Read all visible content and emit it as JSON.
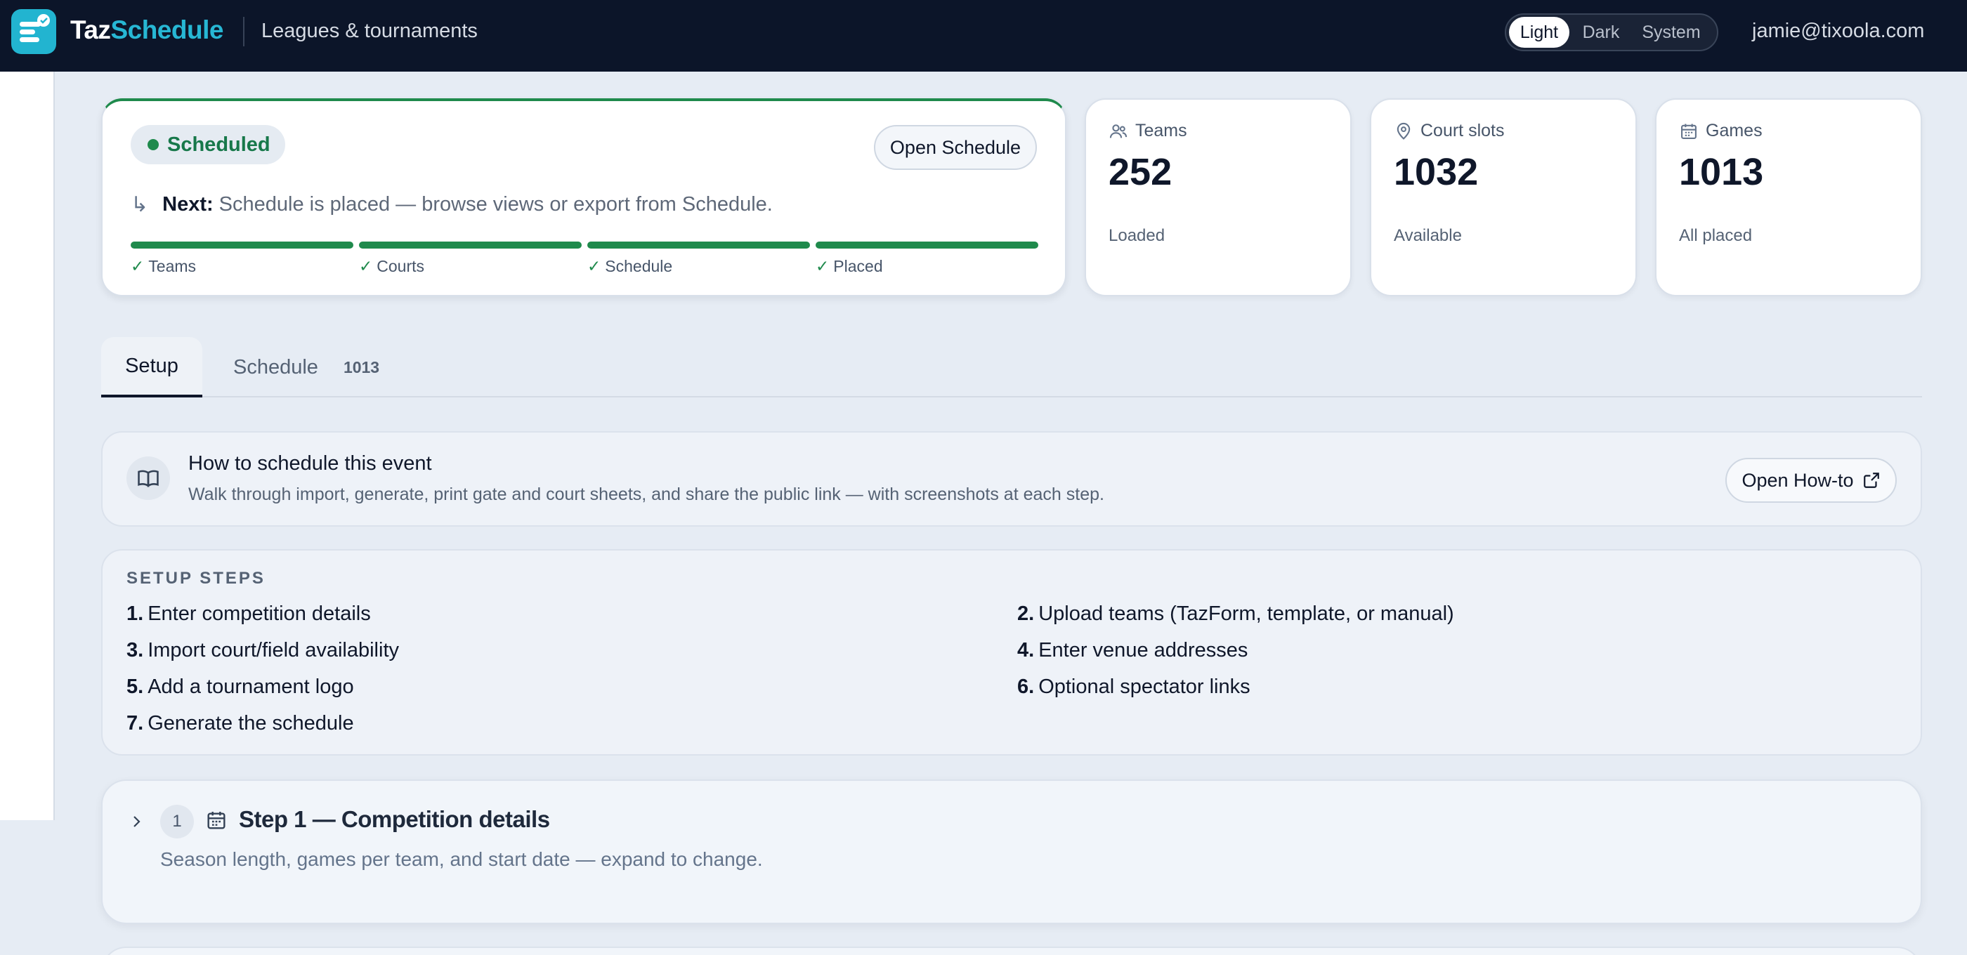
{
  "app": {
    "brand_part1": "Taz",
    "brand_part2": "Schedule",
    "subtitle": "Leagues & tournaments",
    "user_email": "jamie@tixoola.com"
  },
  "theme": {
    "options": [
      "Light",
      "Dark",
      "System"
    ],
    "selected": "Light"
  },
  "status": {
    "label": "Scheduled",
    "open_button": "Open Schedule",
    "next_label": "Next:",
    "next_text": "Schedule is placed — browse views or export from Schedule.",
    "steps": [
      {
        "label": "Teams",
        "complete": true
      },
      {
        "label": "Courts",
        "complete": true
      },
      {
        "label": "Schedule",
        "complete": true
      },
      {
        "label": "Placed",
        "complete": true
      }
    ]
  },
  "stats": [
    {
      "label": "Teams",
      "value": "252",
      "sub": "Loaded",
      "icon": "users-icon"
    },
    {
      "label": "Court slots",
      "value": "1032",
      "sub": "Available",
      "icon": "map-pin-icon"
    },
    {
      "label": "Games",
      "value": "1013",
      "sub": "All placed",
      "icon": "calendar-icon"
    }
  ],
  "tabs": {
    "setup": "Setup",
    "schedule": "Schedule",
    "schedule_count": "1013"
  },
  "howto": {
    "title": "How to schedule this event",
    "description": "Walk through import, generate, print gate and court sheets, and share the public link — with screenshots at each step.",
    "button": "Open How-to"
  },
  "setup_steps": {
    "heading": "SETUP STEPS",
    "items": [
      {
        "num": "1.",
        "text": "Enter competition details"
      },
      {
        "num": "2.",
        "text": "Upload teams (TazForm, template, or manual)"
      },
      {
        "num": "3.",
        "text": "Import court/field availability"
      },
      {
        "num": "4.",
        "text": "Enter venue addresses"
      },
      {
        "num": "5.",
        "text": "Add a tournament logo"
      },
      {
        "num": "6.",
        "text": "Optional spectator links"
      },
      {
        "num": "7.",
        "text": "Generate the schedule"
      }
    ]
  },
  "step1": {
    "number": "1",
    "title": "Step 1 — Competition details",
    "description": "Season length, games per team, and start date — expand to change."
  },
  "colors": {
    "topbar": "#0c1529",
    "brand_accent": "#27b7d4",
    "success": "#1f8a4c"
  }
}
